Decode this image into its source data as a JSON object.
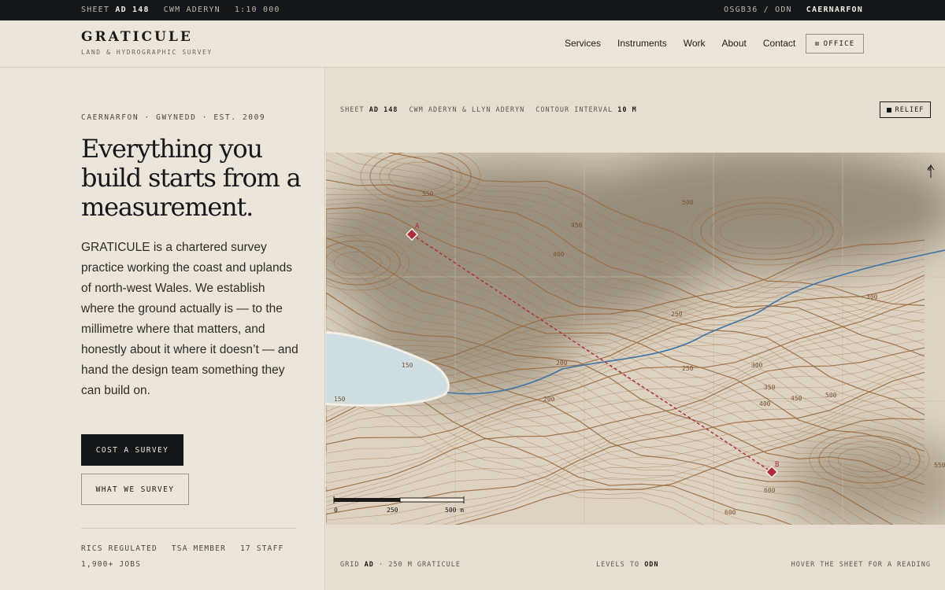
{
  "topbar": {
    "sheet_prefix": "SHEET",
    "sheet_code": "AD 148",
    "area": "CWM ADERYN",
    "scale": "1:10 000",
    "datum": "OSGB36 / ODN",
    "town": "CAERNARFON"
  },
  "brand": {
    "name": "GRATICULE",
    "tagline": "LAND & HYDROGRAPHIC SURVEY"
  },
  "nav": [
    "Services",
    "Instruments",
    "Work",
    "About",
    "Contact"
  ],
  "office_label": "OFFICE",
  "hero": {
    "eyebrow": "CAERNARFON · GWYNEDD · EST. 2009",
    "headline": "Everything you build starts from a measurement.",
    "lede": "GRATICULE is a chartered survey practice working the coast and uplands of north-west Wales. We establish where the ground actually is — to the millimetre where that matters, and honestly about it where it doesn’t — and hand the design team something they can build on.",
    "cta_primary": "COST A SURVEY",
    "cta_secondary": "WHAT WE SURVEY",
    "facts": [
      "RICS REGULATED",
      "TSA MEMBER",
      "17 STAFF",
      "1,900+ JOBS"
    ]
  },
  "map": {
    "sheet_prefix": "SHEET",
    "sheet_code": "AD 148",
    "locality": "CWM ADERYN & LLYN ADERYN",
    "interval_prefix": "CONTOUR INTERVAL",
    "interval_value": "10 M",
    "relief_label": "RELIEF",
    "point_a": "A",
    "point_b": "B",
    "north_label": "N",
    "contour_labels": [
      "550",
      "500",
      "450",
      "400",
      "250",
      "200",
      "150",
      "150",
      "200",
      "250",
      "300",
      "300",
      "350",
      "400",
      "450",
      "500",
      "550",
      "600",
      "600"
    ],
    "scale_ticks": [
      "0",
      "250",
      "500 m"
    ],
    "footer_grid_prefix": "GRID",
    "footer_grid_code": "AD",
    "footer_grid_rest": "· 250 M GRATICULE",
    "footer_levels_prefix": "LEVELS TO",
    "footer_levels_value": "ODN",
    "footer_hint": "HOVER THE SHEET FOR A READING",
    "colors": {
      "contour": "#9a6a3e",
      "river": "#3f76a6",
      "lake": "#cfdee2",
      "line": "#b02a3e"
    }
  }
}
